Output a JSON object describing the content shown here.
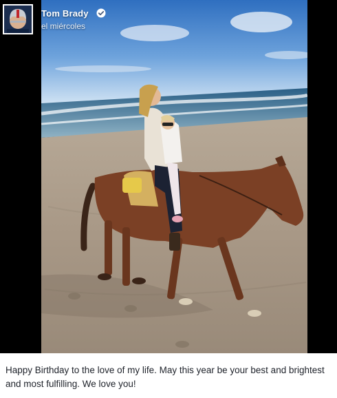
{
  "post": {
    "author_name": "Tom Brady",
    "timestamp": "el miércoles",
    "caption": "Happy Birthday to the love of my life. May this year be your best and brightest and most fulfilling. We love you!"
  },
  "icons": {
    "verified": "verified-badge-icon",
    "avatar": "profile-avatar"
  },
  "colors": {
    "frame_background": "#000000",
    "caption_text": "#1d2129",
    "author_text": "#ffffff"
  }
}
